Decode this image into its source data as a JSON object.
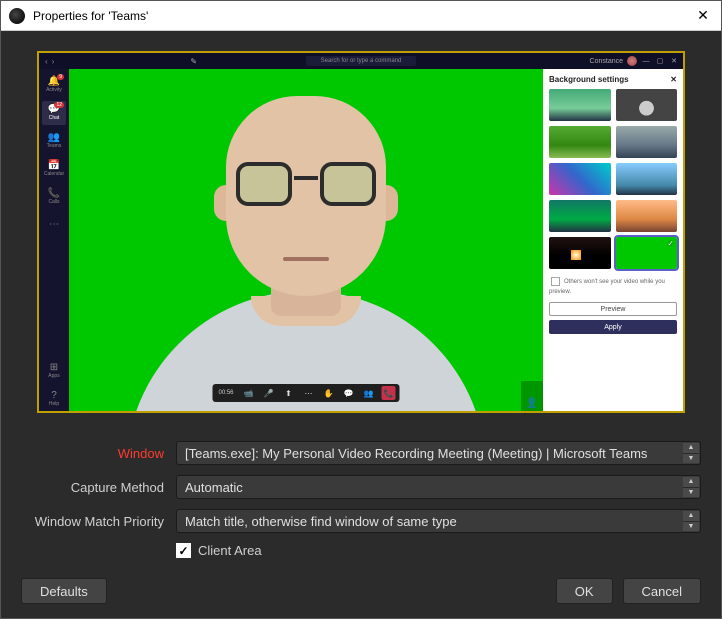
{
  "titlebar": {
    "title": "Properties for 'Teams'",
    "close": "✕"
  },
  "teams": {
    "search_placeholder": "Search for or type a command",
    "user_name": "Constance",
    "sidebar": [
      {
        "icon": "🔔",
        "label": "Activity",
        "badge": "9"
      },
      {
        "icon": "💬",
        "label": "Chat",
        "badge": "12",
        "active": true
      },
      {
        "icon": "👥",
        "label": "Teams"
      },
      {
        "icon": "📅",
        "label": "Calendar"
      },
      {
        "icon": "📞",
        "label": "Calls",
        "badge": ""
      },
      {
        "icon": "⋯",
        "label": ""
      }
    ],
    "sidebar_bottom": [
      {
        "icon": "⊞",
        "label": "Apps"
      },
      {
        "icon": "?",
        "label": "Help"
      }
    ],
    "call": {
      "time": "00:56",
      "buttons": [
        "video-icon",
        "mic-icon",
        "share-icon",
        "more-icon",
        "raise-hand-icon",
        "chat-icon",
        "people-icon",
        "hangup-icon"
      ]
    },
    "bg_panel": {
      "title": "Background settings",
      "note": "Others won't see your video while you preview.",
      "preview": "Preview",
      "apply": "Apply"
    }
  },
  "form": {
    "window_label": "Window",
    "window_value": "[Teams.exe]: My Personal Video Recording Meeting (Meeting) | Microsoft Teams",
    "capture_label": "Capture Method",
    "capture_value": "Automatic",
    "priority_label": "Window Match Priority",
    "priority_value": "Match title, otherwise find window of same type",
    "client_area": "Client Area"
  },
  "buttons": {
    "defaults": "Defaults",
    "ok": "OK",
    "cancel": "Cancel"
  }
}
